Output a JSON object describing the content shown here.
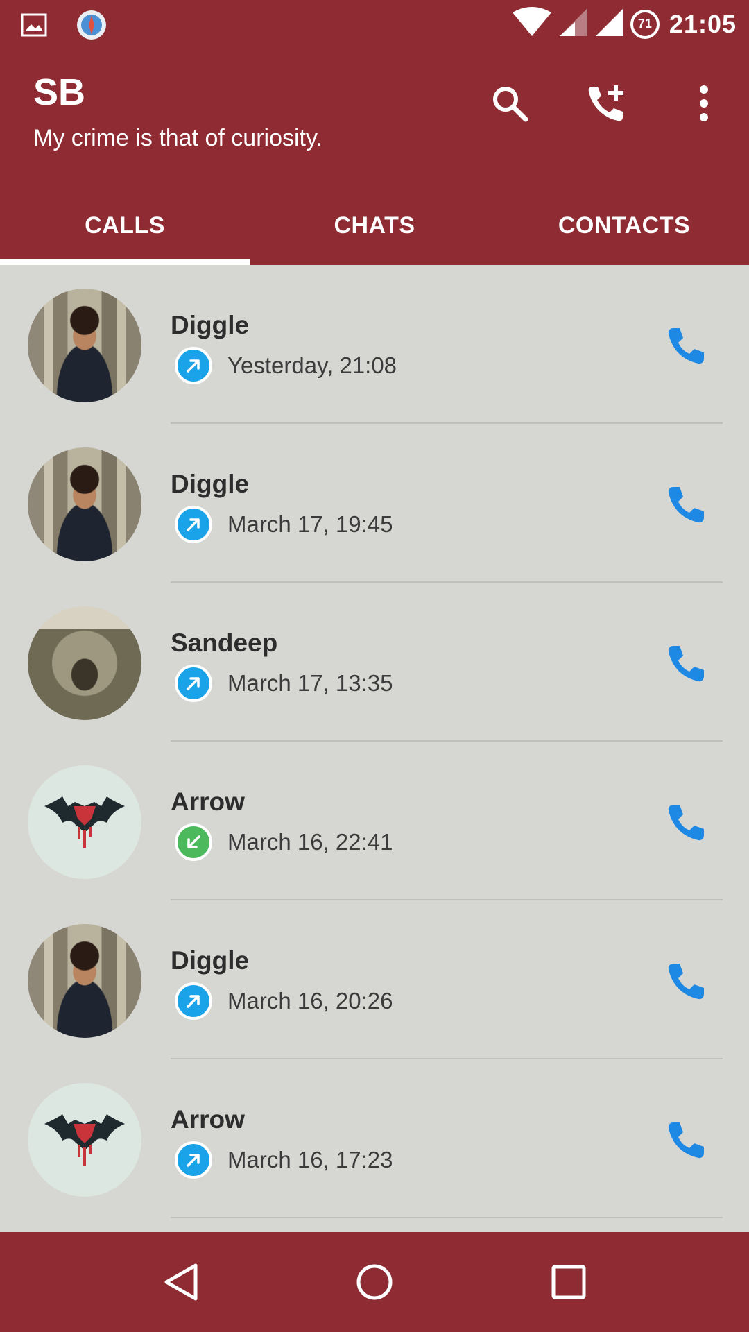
{
  "status_bar": {
    "time": "21:05",
    "battery_level": "71",
    "icons": [
      "gallery-icon",
      "browser-icon",
      "wifi-icon",
      "signal-icon",
      "signal-icon",
      "battery-icon"
    ]
  },
  "app_bar": {
    "title": "SB",
    "subtitle": "My crime is that of curiosity.",
    "actions": [
      "search-icon",
      "add-call-icon",
      "more-vert-icon"
    ]
  },
  "tabs": [
    {
      "label": "CALLS",
      "active": true
    },
    {
      "label": "CHATS",
      "active": false
    },
    {
      "label": "CONTACTS",
      "active": false
    }
  ],
  "calls": [
    {
      "name": "Diggle",
      "time": "Yesterday, 21:08",
      "direction": "outgoing"
    },
    {
      "name": "Diggle",
      "time": "March 17, 19:45",
      "direction": "outgoing"
    },
    {
      "name": "Sandeep",
      "time": "March 17, 13:35",
      "direction": "outgoing"
    },
    {
      "name": "Arrow",
      "time": "March 16, 22:41",
      "direction": "incoming"
    },
    {
      "name": "Diggle",
      "time": "March 16, 20:26",
      "direction": "outgoing"
    },
    {
      "name": "Arrow",
      "time": "March 16, 17:23",
      "direction": "outgoing"
    }
  ],
  "colors": {
    "primary": "#8e2b33",
    "list_background": "#d6d7d3",
    "outgoing": "#1aa3e8",
    "incoming": "#4cba5c",
    "call_button": "#1e88e5"
  },
  "nav_bar": [
    "back-icon",
    "home-icon",
    "recents-icon"
  ]
}
